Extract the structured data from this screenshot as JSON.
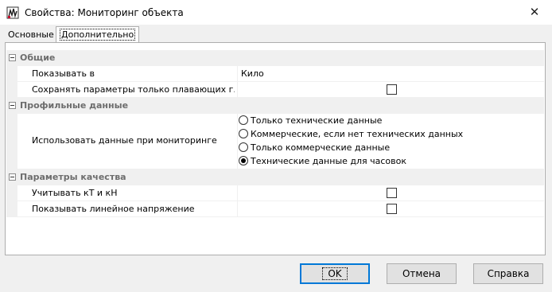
{
  "window": {
    "title": "Свойства: Мониторинг объекта",
    "close_glyph": "✕"
  },
  "tabs": [
    {
      "label": "Основные",
      "active": false
    },
    {
      "label": "Дополнительно",
      "active": true
    }
  ],
  "categories": [
    {
      "label": "Общие"
    },
    {
      "label": "Профильные данные"
    },
    {
      "label": "Параметры качества"
    }
  ],
  "properties": {
    "show_in": {
      "label": "Показывать в",
      "value": "Кило"
    },
    "save_floating": {
      "label": "Сохранять параметры только плавающих г...",
      "checked": false
    },
    "use_data": {
      "label": "Использовать данные при мониторинге",
      "options": [
        {
          "label": "Только технические данные",
          "selected": false
        },
        {
          "label": "Коммерческие, если нет технических данных",
          "selected": false
        },
        {
          "label": "Только коммерческие данные",
          "selected": false
        },
        {
          "label": "Технические данные для часовок",
          "selected": true
        }
      ]
    },
    "account_kt_kn": {
      "label": "Учитывать кТ и кН",
      "checked": false
    },
    "show_line_voltage": {
      "label": "Показывать линейное напряжение",
      "checked": false
    }
  },
  "buttons": {
    "ok": "OK",
    "cancel": "Отмена",
    "help": "Справка"
  },
  "colors": {
    "accent": "#0078d7",
    "category_bg": "#f0f0f0",
    "category_text": "#6d6d6d"
  }
}
